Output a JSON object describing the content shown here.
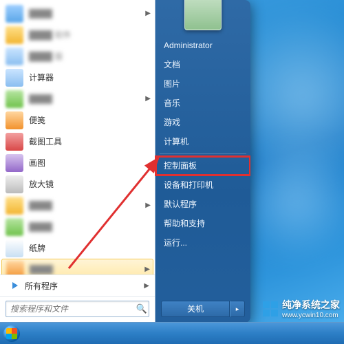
{
  "user": {
    "name": "Administrator"
  },
  "left_programs": [
    {
      "label": "████",
      "blurred": true,
      "arrow": true,
      "icon": "ic-a"
    },
    {
      "label": "████ 软件",
      "blurred": true,
      "arrow": false,
      "icon": "ic-b"
    },
    {
      "label": "████ 版",
      "blurred": true,
      "arrow": false,
      "icon": "ic-e"
    },
    {
      "label": "计算器",
      "blurred": false,
      "arrow": false,
      "icon": "ic-e"
    },
    {
      "label": "████",
      "blurred": true,
      "arrow": true,
      "icon": "ic-c"
    },
    {
      "label": "便笺",
      "blurred": false,
      "arrow": false,
      "icon": "ic-f"
    },
    {
      "label": "截图工具",
      "blurred": false,
      "arrow": false,
      "icon": "ic-g"
    },
    {
      "label": "画图",
      "blurred": false,
      "arrow": false,
      "icon": "ic-h"
    },
    {
      "label": "放大镜",
      "blurred": false,
      "arrow": false,
      "icon": "ic-i"
    },
    {
      "label": "████",
      "blurred": true,
      "arrow": true,
      "icon": "ic-b"
    },
    {
      "label": "████",
      "blurred": true,
      "arrow": false,
      "icon": "ic-c"
    },
    {
      "label": "纸牌",
      "blurred": false,
      "arrow": false,
      "icon": "ic-j"
    },
    {
      "label": "████",
      "blurred": true,
      "arrow": true,
      "icon": "ic-f",
      "selected": true
    }
  ],
  "all_programs_label": "所有程序",
  "search": {
    "placeholder": "搜索程序和文件"
  },
  "right_items": [
    {
      "label": "Administrator",
      "key": "user"
    },
    {
      "label": "文档",
      "key": "documents"
    },
    {
      "label": "图片",
      "key": "pictures"
    },
    {
      "label": "音乐",
      "key": "music"
    },
    {
      "label": "游戏",
      "key": "games"
    },
    {
      "label": "计算机",
      "key": "computer"
    },
    {
      "sep": true
    },
    {
      "label": "控制面板",
      "key": "control-panel",
      "highlight": true
    },
    {
      "label": "设备和打印机",
      "key": "devices"
    },
    {
      "label": "默认程序",
      "key": "defaults"
    },
    {
      "label": "帮助和支持",
      "key": "help"
    },
    {
      "label": "运行...",
      "key": "run"
    }
  ],
  "power": {
    "label": "关机"
  },
  "watermark": {
    "title": "纯净系统之家",
    "url": "www.ycwin10.com"
  },
  "highlight_color": "#e03030"
}
